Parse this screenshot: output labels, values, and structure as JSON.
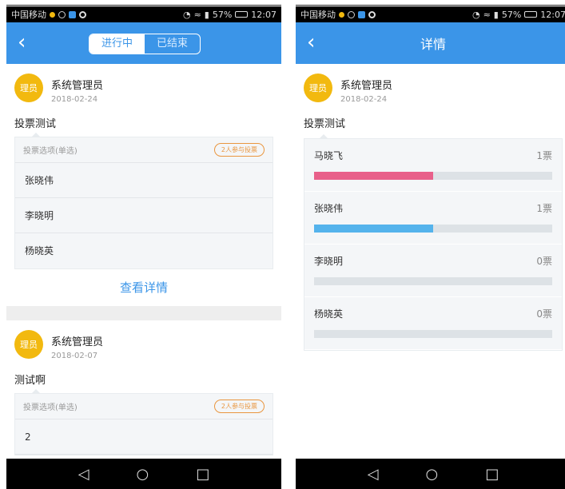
{
  "status": {
    "carrier": "中国移动",
    "battery": "57%",
    "time": "12:07"
  },
  "left": {
    "tabs": [
      "进行中",
      "已结束"
    ],
    "active_tab": 0,
    "posts": [
      {
        "avatar_text": "理员",
        "author": "系统管理员",
        "date": "2018-02-24",
        "title": "投票测试",
        "box_header": "投票选项(单选)",
        "participants": "2人参与投票",
        "options": [
          "张晓伟",
          "李晓明",
          "杨晓英"
        ],
        "detail_link": "查看详情"
      },
      {
        "avatar_text": "理员",
        "author": "系统管理员",
        "date": "2018-02-07",
        "title": "测试啊",
        "box_header": "投票选项(单选)",
        "participants": "2人参与投票",
        "options": [
          "2"
        ]
      }
    ]
  },
  "right": {
    "title": "详情",
    "avatar_text": "理员",
    "author": "系统管理员",
    "date": "2018-02-24",
    "poll_title": "投票测试",
    "results": [
      {
        "name": "马晓飞",
        "votes": "1票",
        "share": 0.5,
        "color": "#e8608a"
      },
      {
        "name": "张晓伟",
        "votes": "1票",
        "share": 0.5,
        "color": "#54b3ec"
      },
      {
        "name": "李晓明",
        "votes": "0票",
        "share": 0,
        "color": "#54b3ec"
      },
      {
        "name": "杨晓英",
        "votes": "0票",
        "share": 0,
        "color": "#54b3ec"
      }
    ]
  },
  "colors": {
    "accent": "#3b95e8",
    "avatar": "#f2b90f",
    "pill": "#e9963f"
  },
  "icons": {
    "back": "chevron-left-icon",
    "nav": [
      "back-triangle-icon",
      "home-circle-icon",
      "recents-square-icon"
    ]
  }
}
